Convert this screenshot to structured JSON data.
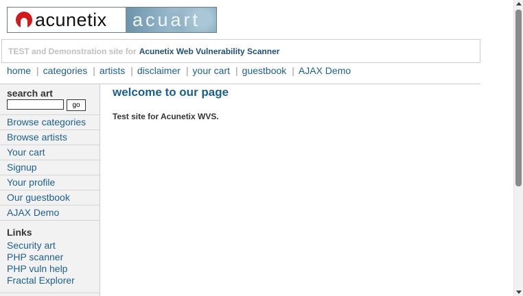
{
  "logo": {
    "left_text": "acunetix",
    "right_text": "acuart"
  },
  "tagline": {
    "prefix": "TEST and Demonstration site for",
    "link": "Acunetix Web Vulnerability Scanner"
  },
  "topnav": [
    "home",
    "categories",
    "artists",
    "disclaimer",
    "your cart",
    "guestbook",
    "AJAX Demo"
  ],
  "sidebar": {
    "search_title": "search art",
    "search_value": "",
    "go_label": "go",
    "menu": [
      "Browse categories",
      "Browse artists",
      "Your cart",
      "Signup",
      "Your profile",
      "Our guestbook",
      "AJAX Demo"
    ],
    "links_title": "Links",
    "links": [
      "Security art",
      "PHP scanner",
      "PHP vuln help",
      "Fractal Explorer"
    ]
  },
  "content": {
    "title": "welcome to our page",
    "text": "Test site for Acunetix WVS."
  },
  "colors": {
    "link": "#1b5f90",
    "brand_red": "#d11a1a"
  }
}
